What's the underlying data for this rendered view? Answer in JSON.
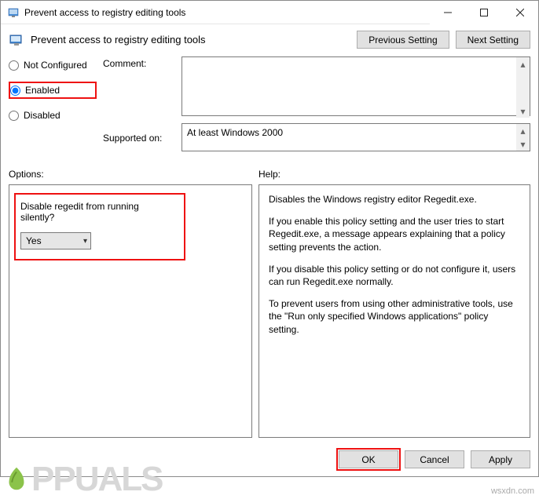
{
  "window": {
    "title": "Prevent access to registry editing tools",
    "header_title": "Prevent access to registry editing tools",
    "prev_button": "Previous Setting",
    "next_button": "Next Setting"
  },
  "radios": {
    "not_configured": "Not Configured",
    "enabled": "Enabled",
    "disabled": "Disabled",
    "selected": "enabled"
  },
  "labels": {
    "comment": "Comment:",
    "supported_on": "Supported on:",
    "options": "Options:",
    "help": "Help:"
  },
  "fields": {
    "comment_value": "",
    "supported_value": "At least Windows 2000"
  },
  "options_panel": {
    "question": "Disable regedit from running silently?",
    "combo_value": "Yes"
  },
  "help_panel": {
    "p1": "Disables the Windows registry editor Regedit.exe.",
    "p2": "If you enable this policy setting and the user tries to start Regedit.exe, a message appears explaining that a policy setting prevents the action.",
    "p3": "If you disable this policy setting or do not configure it, users can run Regedit.exe normally.",
    "p4": "To prevent users from using other administrative tools, use the \"Run only specified Windows applications\" policy setting."
  },
  "footer": {
    "ok": "OK",
    "cancel": "Cancel",
    "apply": "Apply"
  },
  "watermark": {
    "text": "PPUALS",
    "source": "wsxdn.com"
  }
}
